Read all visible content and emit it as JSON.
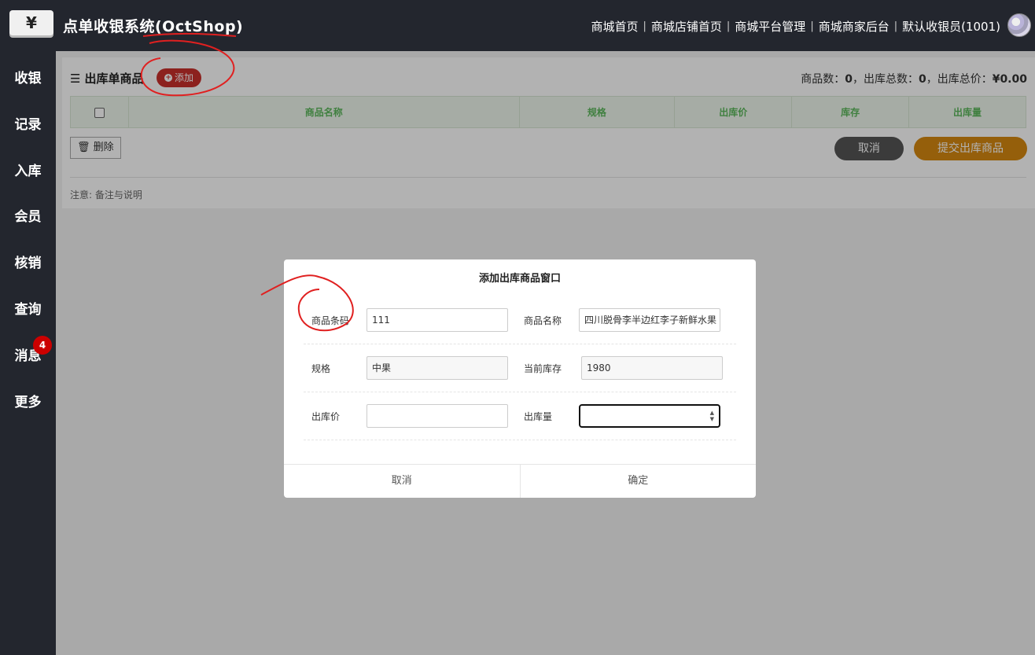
{
  "header": {
    "logo_glyph": "¥",
    "app_title": "点单收银系统(OctShop)",
    "nav": [
      "商城首页",
      "商城店铺首页",
      "商城平台管理",
      "商城商家后台",
      "默认收银员(1001)"
    ]
  },
  "sidebar": {
    "items": [
      {
        "label": "收银"
      },
      {
        "label": "记录"
      },
      {
        "label": "入库"
      },
      {
        "label": "会员"
      },
      {
        "label": "核销"
      },
      {
        "label": "查询"
      },
      {
        "label": "消息",
        "badge": "4"
      },
      {
        "label": "更多"
      }
    ]
  },
  "panel": {
    "title": "出库单商品",
    "add_label": "添加",
    "summary": {
      "goods_count_label": "商品数：",
      "goods_count": "0",
      "total_qty_label": "，出库总数：",
      "total_qty": "0",
      "total_price_label": "，出库总价：",
      "total_price": "¥0.00"
    },
    "table_headers": [
      "商品名称",
      "规格",
      "出库价",
      "库存",
      "出库量"
    ],
    "delete_label": "删除",
    "cancel_label": "取消",
    "submit_label": "提交出库商品",
    "note": "注意: 备注与说明"
  },
  "modal": {
    "title": "添加出库商品窗口",
    "fields": {
      "barcode_label": "商品条码",
      "barcode_value": "111",
      "name_label": "商品名称",
      "name_value": "四川脱骨李半边红李子新鲜水果",
      "spec_label": "规格",
      "spec_value": "中果",
      "stock_label": "当前库存",
      "stock_value": "1980",
      "price_label": "出库价",
      "price_value": "",
      "qty_label": "出库量",
      "qty_value": ""
    },
    "cancel_label": "取消",
    "confirm_label": "确定"
  },
  "colors": {
    "dark_bg": "#23262e",
    "add_button": "#c9302c",
    "submit_button": "#d68910",
    "table_header_text": "#5cb85c",
    "annotation": "#e02020"
  }
}
